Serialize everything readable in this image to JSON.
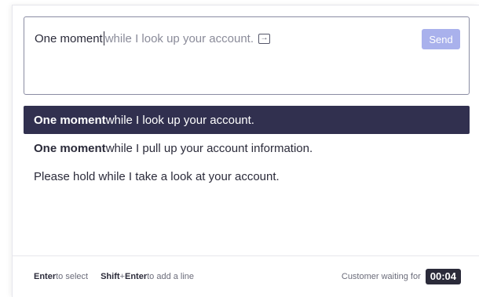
{
  "composer": {
    "typed_text": "One moment",
    "ghost_completion": "while I look up your account.",
    "enter_icon": "enter-key-icon",
    "enter_glyph": "→",
    "send_label": "Send"
  },
  "suggestions": [
    {
      "bold": "One moment",
      "rest": " while I look up your account.",
      "selected": true
    },
    {
      "bold": "One moment",
      "rest": " while I pull up your account information.",
      "selected": false
    },
    {
      "bold": "",
      "rest": "Please hold while I take a look at your account.",
      "selected": false
    }
  ],
  "footer": {
    "enter_key": "Enter",
    "enter_action": " to select",
    "shift_key": "Shift",
    "plus": " + ",
    "enter_key2": "Enter",
    "shift_action": " to add a line",
    "waiting_label": "Customer waiting for",
    "timer": "00:04"
  },
  "colors": {
    "selected_bg": "#31304f",
    "send_bg": "#a9b1ec",
    "timer_bg": "#2b2b3a"
  }
}
